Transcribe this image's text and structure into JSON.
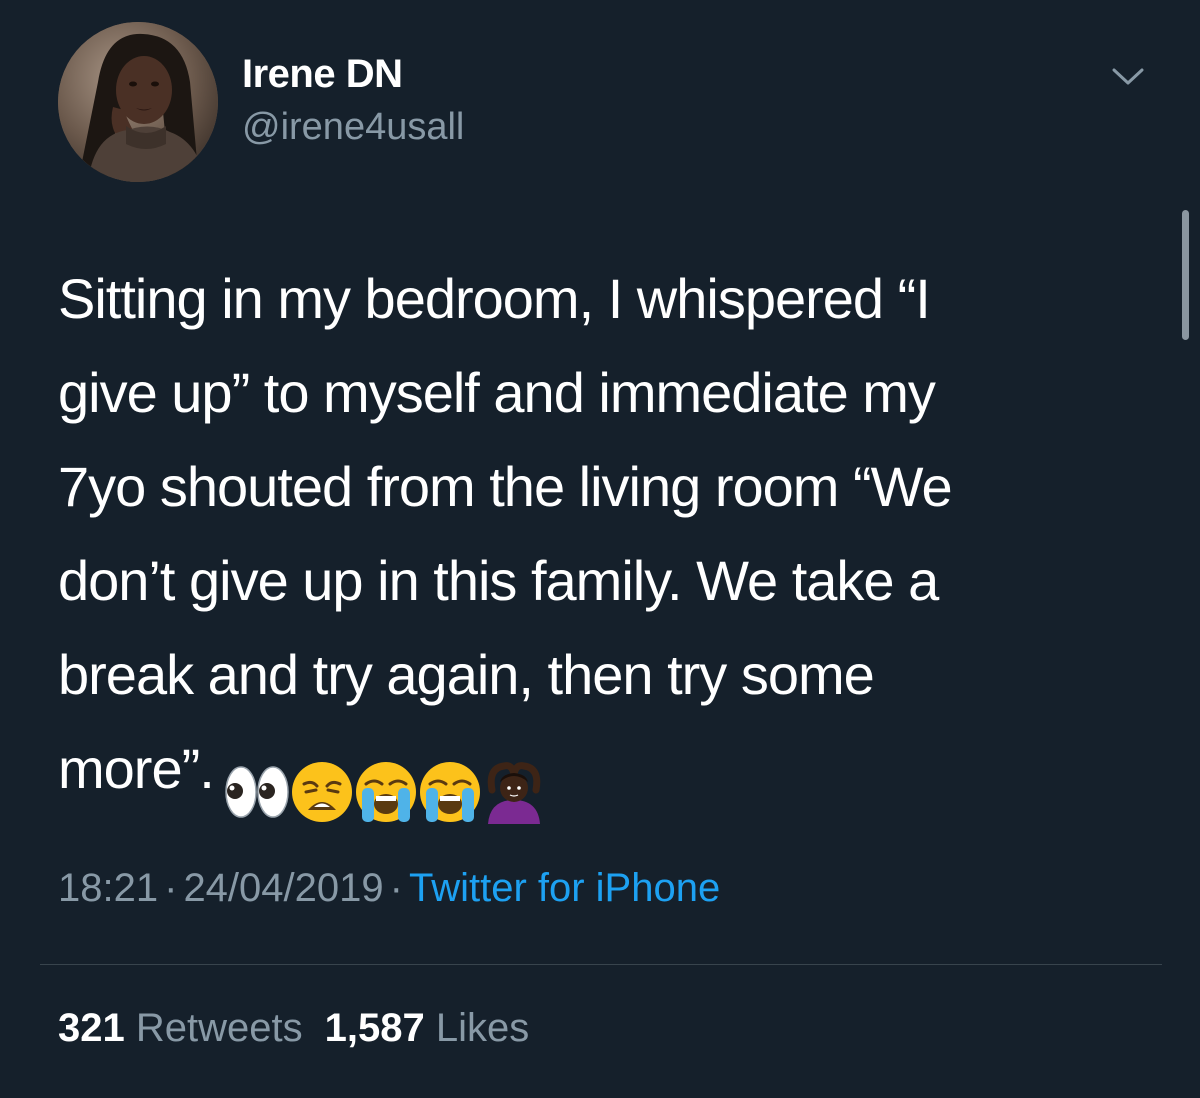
{
  "author": {
    "display_name": "Irene DN",
    "handle": "@irene4usall"
  },
  "tweet": {
    "lines": [
      "Sitting in my bedroom, I whispered “I",
      "give up” to myself and immediate my",
      "7yo shouted from the living room “We",
      "don’t give up in this family. We take a",
      "break and try again, then try some",
      "more”."
    ],
    "emojis": [
      "eyes-emoji",
      "weary-face-emoji",
      "loudly-crying-face-emoji",
      "loudly-crying-face-emoji",
      "person-gesturing-ok-emoji"
    ]
  },
  "meta": {
    "time": "18:21",
    "separator": "·",
    "date": "24/04/2019",
    "source": "Twitter for iPhone"
  },
  "stats": {
    "retweets_count": "321",
    "retweets_label": "Retweets",
    "likes_count": "1,587",
    "likes_label": "Likes"
  },
  "colors": {
    "background": "#15202b",
    "text": "#ffffff",
    "secondary": "#8899a6",
    "link": "#1da1f2",
    "divider": "#38444d"
  },
  "icons": {
    "menu": "chevron-down-icon"
  }
}
